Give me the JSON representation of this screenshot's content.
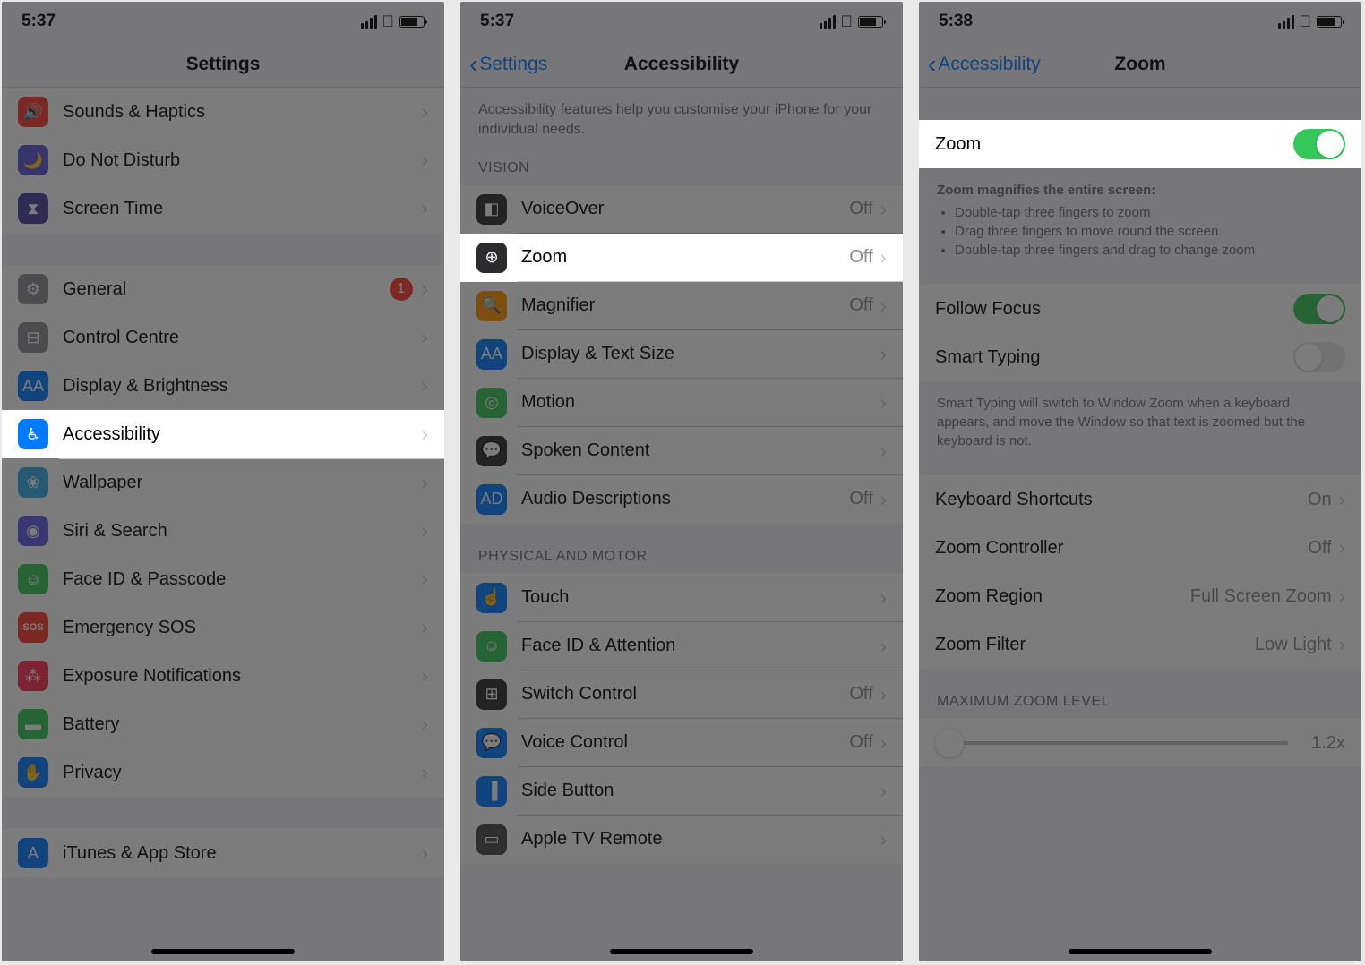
{
  "screen1": {
    "status": {
      "time": "5:37"
    },
    "title": "Settings",
    "items": [
      {
        "label": "Sounds & Haptics",
        "icon": "sounds-icon",
        "color": "ic-red",
        "glyph": "🔊"
      },
      {
        "label": "Do Not Disturb",
        "icon": "dnd-icon",
        "color": "ic-purple",
        "glyph": "🌙"
      },
      {
        "label": "Screen Time",
        "icon": "screentime-icon",
        "color": "ic-darkpurple",
        "glyph": "⧗"
      }
    ],
    "items2": [
      {
        "label": "General",
        "icon": "general-icon",
        "color": "ic-gray",
        "glyph": "⚙",
        "badge": "1"
      },
      {
        "label": "Control Centre",
        "icon": "controlcentre-icon",
        "color": "ic-gray",
        "glyph": "⊟"
      },
      {
        "label": "Display & Brightness",
        "icon": "display-icon",
        "color": "ic-blue",
        "glyph": "AA"
      },
      {
        "label": "Accessibility",
        "icon": "accessibility-icon",
        "color": "ic-blue",
        "glyph": "♿︎",
        "highlight": true
      },
      {
        "label": "Wallpaper",
        "icon": "wallpaper-icon",
        "color": "ic-teal",
        "glyph": "❀"
      },
      {
        "label": "Siri & Search",
        "icon": "siri-icon",
        "color": "ic-indigo",
        "glyph": "◉"
      },
      {
        "label": "Face ID & Passcode",
        "icon": "faceid-icon",
        "color": "ic-green",
        "glyph": "☺"
      },
      {
        "label": "Emergency SOS",
        "icon": "sos-icon",
        "color": "ic-red",
        "glyph": "SOS"
      },
      {
        "label": "Exposure Notifications",
        "icon": "exposure-icon",
        "color": "ic-redpink",
        "glyph": "⁂"
      },
      {
        "label": "Battery",
        "icon": "battery-icon",
        "color": "ic-green",
        "glyph": "▬"
      },
      {
        "label": "Privacy",
        "icon": "privacy-icon",
        "color": "ic-blue",
        "glyph": "✋"
      }
    ],
    "items3": [
      {
        "label": "iTunes & App Store",
        "icon": "appstore-icon",
        "color": "ic-blue",
        "glyph": "A"
      }
    ]
  },
  "screen2": {
    "status": {
      "time": "5:37"
    },
    "back": "Settings",
    "title": "Accessibility",
    "intro": "Accessibility features help you customise your iPhone for your individual needs.",
    "visionHeader": "VISION",
    "visionItems": [
      {
        "label": "VoiceOver",
        "value": "Off",
        "icon": "voiceover-icon",
        "color": "ic-dark",
        "glyph": "◧"
      },
      {
        "label": "Zoom",
        "value": "Off",
        "icon": "zoom-icon",
        "color": "ic-dark",
        "glyph": "⊕",
        "highlight": true
      },
      {
        "label": "Magnifier",
        "value": "Off",
        "icon": "magnifier-icon",
        "color": "ic-orange",
        "glyph": "🔍"
      },
      {
        "label": "Display & Text Size",
        "value": "",
        "icon": "textsize-icon",
        "color": "ic-blue",
        "glyph": "AA"
      },
      {
        "label": "Motion",
        "value": "",
        "icon": "motion-icon",
        "color": "ic-green",
        "glyph": "◎"
      },
      {
        "label": "Spoken Content",
        "value": "",
        "icon": "spoken-icon",
        "color": "ic-dark",
        "glyph": "💬"
      },
      {
        "label": "Audio Descriptions",
        "value": "Off",
        "icon": "audiodesc-icon",
        "color": "ic-blue",
        "glyph": "AD"
      }
    ],
    "motorHeader": "PHYSICAL AND MOTOR",
    "motorItems": [
      {
        "label": "Touch",
        "value": "",
        "icon": "touch-icon",
        "color": "ic-blue",
        "glyph": "☝"
      },
      {
        "label": "Face ID & Attention",
        "value": "",
        "icon": "faceid2-icon",
        "color": "ic-green",
        "glyph": "☺"
      },
      {
        "label": "Switch Control",
        "value": "Off",
        "icon": "switch-icon",
        "color": "ic-dark",
        "glyph": "⊞"
      },
      {
        "label": "Voice Control",
        "value": "Off",
        "icon": "voicectrl-icon",
        "color": "ic-blue",
        "glyph": "💬"
      },
      {
        "label": "Side Button",
        "value": "",
        "icon": "sidebtn-icon",
        "color": "ic-blue",
        "glyph": "▐"
      },
      {
        "label": "Apple TV Remote",
        "value": "",
        "icon": "tvremote-icon",
        "color": "ic-darkgray",
        "glyph": "▭"
      }
    ]
  },
  "screen3": {
    "status": {
      "time": "5:38"
    },
    "back": "Accessibility",
    "title": "Zoom",
    "zoomRow": {
      "label": "Zoom",
      "on": true
    },
    "zoomDescTitle": "Zoom magnifies the entire screen:",
    "zoomDescBullets": [
      "Double-tap three fingers to zoom",
      "Drag three fingers to move round the screen",
      "Double-tap three fingers and drag to change zoom"
    ],
    "followFocus": {
      "label": "Follow Focus",
      "on": true
    },
    "smartTyping": {
      "label": "Smart Typing",
      "on": false
    },
    "smartTypingDesc": "Smart Typing will switch to Window Zoom when a keyboard appears, and move the Window so that text is zoomed but the keyboard is not.",
    "navItems": [
      {
        "label": "Keyboard Shortcuts",
        "value": "On"
      },
      {
        "label": "Zoom Controller",
        "value": "Off"
      },
      {
        "label": "Zoom Region",
        "value": "Full Screen Zoom"
      },
      {
        "label": "Zoom Filter",
        "value": "Low Light"
      }
    ],
    "maxZoomHeader": "MAXIMUM ZOOM LEVEL",
    "maxZoomValue": "1.2x"
  }
}
